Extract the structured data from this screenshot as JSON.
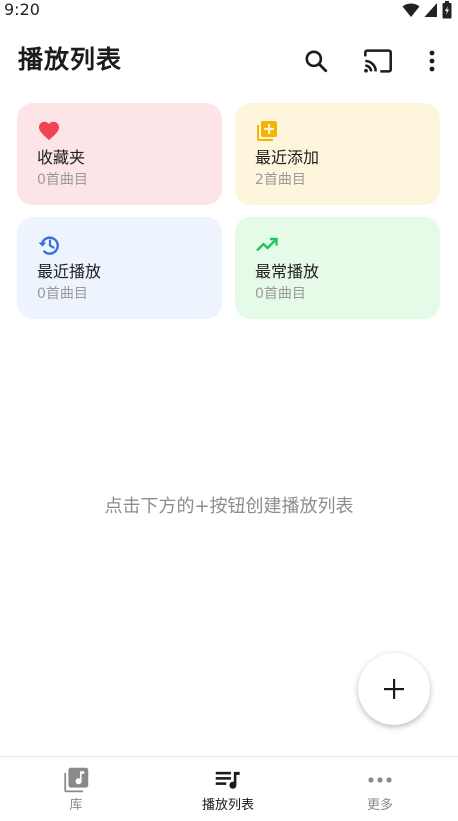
{
  "status_bar": {
    "time": "9:20",
    "icons": [
      "wifi-icon",
      "cellular-signal-icon",
      "battery-icon"
    ]
  },
  "header": {
    "title": "播放列表",
    "actions": [
      "search-icon",
      "cast-icon",
      "more-vert-icon"
    ]
  },
  "cards": [
    {
      "title": "收藏夹",
      "subtitle": "0首曲目",
      "icon": "heart-icon",
      "bg": "#fde5e7",
      "icon_color": "#f04452"
    },
    {
      "title": "最近添加",
      "subtitle": "2首曲目",
      "icon": "add-to-library-icon",
      "bg": "#fdf6dc",
      "icon_color": "#f5b400"
    },
    {
      "title": "最近播放",
      "subtitle": "0首曲目",
      "icon": "history-icon",
      "bg": "#eef4fd",
      "icon_color": "#3d6fd9"
    },
    {
      "title": "最常播放",
      "subtitle": "0首曲目",
      "icon": "trending-up-icon",
      "bg": "#e5fbe7",
      "icon_color": "#22c55e"
    }
  ],
  "empty_hint": "点击下方的+按钮创建播放列表",
  "fab": {
    "icon": "plus-icon"
  },
  "bottom_nav": [
    {
      "label": "库",
      "icon": "library-music-icon",
      "active": false
    },
    {
      "label": "播放列表",
      "icon": "playlist-music-icon",
      "active": true
    },
    {
      "label": "更多",
      "icon": "more-horiz-icon",
      "active": false
    }
  ],
  "colors": {
    "active_nav": "#1a1a1a",
    "inactive_nav": "#8a8a8a"
  }
}
